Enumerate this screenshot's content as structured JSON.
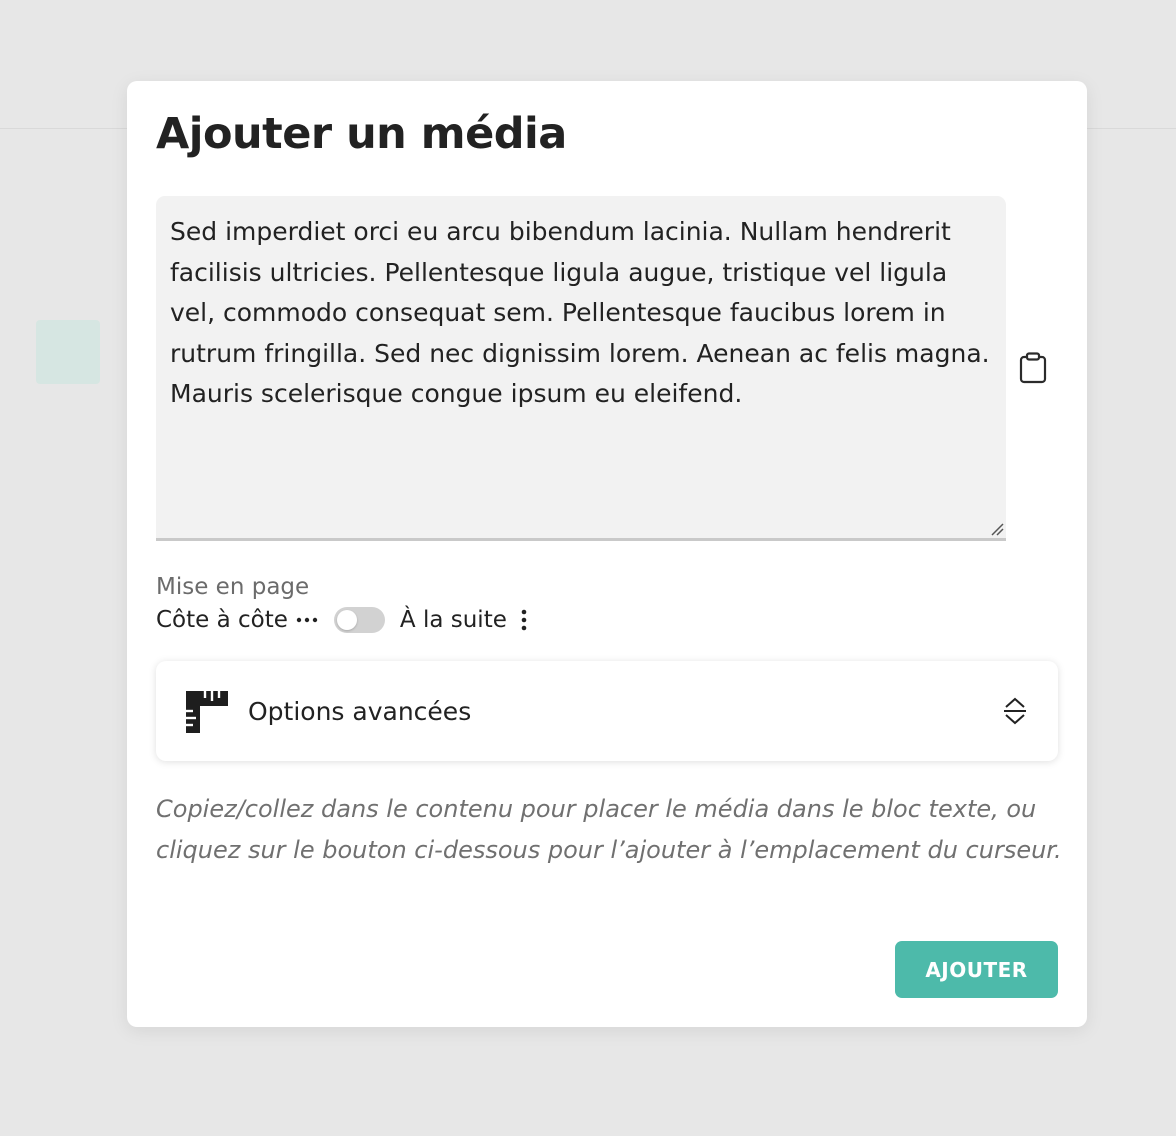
{
  "modal": {
    "title": "Ajouter un média",
    "media_text": "Sed imperdiet orci eu arcu bibendum lacinia. Nullam hendrerit facilisis ultricies. Pellentesque ligula augue, tristique vel ligula vel, commodo consequat sem. Pellentesque faucibus lorem in rutrum fringilla. Sed nec dignissim lorem. Aenean ac felis magna. Mauris scelerisque congue ipsum eu eleifend.",
    "copy_icon": "clipboard-icon",
    "layout": {
      "label": "Mise en page",
      "option_left": "Côte à côte",
      "option_right": "À la suite",
      "toggle_on": false
    },
    "advanced": {
      "label": "Options avancées",
      "icon": "ruler-icon",
      "expand_icon": "expand-collapse-icon"
    },
    "help_text": "Copiez/collez dans le contenu pour placer le média dans le bloc texte, ou cliquez sur le bouton ci-dessous pour l’ajouter à l’emplacement du curseur.",
    "add_button": "AJOUTER"
  },
  "colors": {
    "accent": "#4dbaaa",
    "backdrop": "#e6e6e6",
    "textarea_bg": "#f2f2f2"
  }
}
